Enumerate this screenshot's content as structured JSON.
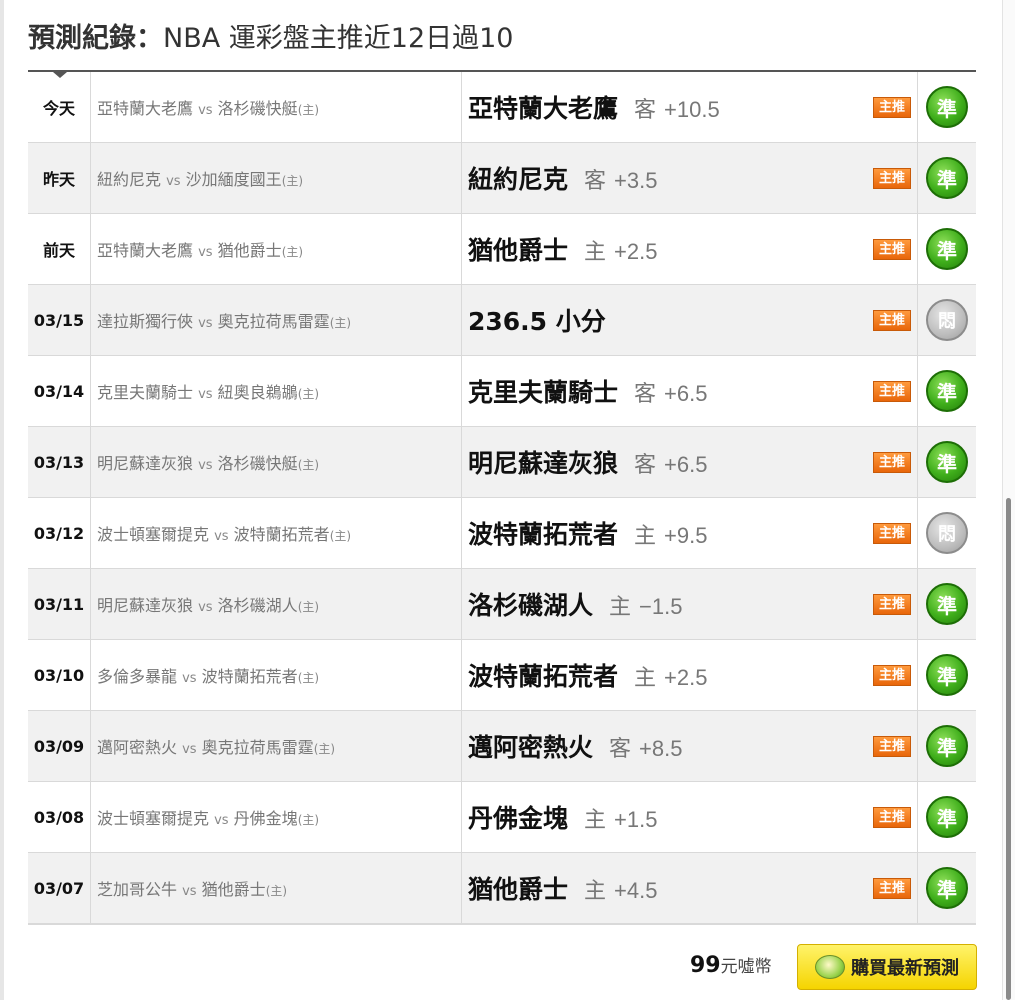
{
  "header": {
    "label": "預測紀錄：",
    "subtitle": "NBA 運彩盤主推近12日過10"
  },
  "records": [
    {
      "date": "今天",
      "away": "亞特蘭大老鷹",
      "vs": "vs",
      "home": "洛杉磯快艇",
      "home_mark": "(主)",
      "pick_team": "亞特蘭大老鷹",
      "pick_side": "客",
      "pick_line": "+10.5",
      "tag": "主推",
      "result": "準"
    },
    {
      "date": "昨天",
      "away": "紐約尼克",
      "vs": "vs",
      "home": "沙加緬度國王",
      "home_mark": "(主)",
      "pick_team": "紐約尼克",
      "pick_side": "客",
      "pick_line": "+3.5",
      "tag": "主推",
      "result": "準"
    },
    {
      "date": "前天",
      "away": "亞特蘭大老鷹",
      "vs": "vs",
      "home": "猶他爵士",
      "home_mark": "(主)",
      "pick_team": "猶他爵士",
      "pick_side": "主",
      "pick_line": "+2.5",
      "tag": "主推",
      "result": "準"
    },
    {
      "date": "03/15",
      "away": "達拉斯獨行俠",
      "vs": "vs",
      "home": "奧克拉荷馬雷霆",
      "home_mark": "(主)",
      "pick_team": "236.5 小分",
      "pick_side": "",
      "pick_line": "",
      "tag": "主推",
      "result": "悶"
    },
    {
      "date": "03/14",
      "away": "克里夫蘭騎士",
      "vs": "vs",
      "home": "紐奧良鵜鶘",
      "home_mark": "(主)",
      "pick_team": "克里夫蘭騎士",
      "pick_side": "客",
      "pick_line": "+6.5",
      "tag": "主推",
      "result": "準"
    },
    {
      "date": "03/13",
      "away": "明尼蘇達灰狼",
      "vs": "vs",
      "home": "洛杉磯快艇",
      "home_mark": "(主)",
      "pick_team": "明尼蘇達灰狼",
      "pick_side": "客",
      "pick_line": "+6.5",
      "tag": "主推",
      "result": "準"
    },
    {
      "date": "03/12",
      "away": "波士頓塞爾提克",
      "vs": "vs",
      "home": "波特蘭拓荒者",
      "home_mark": "(主)",
      "pick_team": "波特蘭拓荒者",
      "pick_side": "主",
      "pick_line": "+9.5",
      "tag": "主推",
      "result": "悶"
    },
    {
      "date": "03/11",
      "away": "明尼蘇達灰狼",
      "vs": "vs",
      "home": "洛杉磯湖人",
      "home_mark": "(主)",
      "pick_team": "洛杉磯湖人",
      "pick_side": "主",
      "pick_line": "−1.5",
      "tag": "主推",
      "result": "準"
    },
    {
      "date": "03/10",
      "away": "多倫多暴龍",
      "vs": "vs",
      "home": "波特蘭拓荒者",
      "home_mark": "(主)",
      "pick_team": "波特蘭拓荒者",
      "pick_side": "主",
      "pick_line": "+2.5",
      "tag": "主推",
      "result": "準"
    },
    {
      "date": "03/09",
      "away": "邁阿密熱火",
      "vs": "vs",
      "home": "奧克拉荷馬雷霆",
      "home_mark": "(主)",
      "pick_team": "邁阿密熱火",
      "pick_side": "客",
      "pick_line": "+8.5",
      "tag": "主推",
      "result": "準"
    },
    {
      "date": "03/08",
      "away": "波士頓塞爾提克",
      "vs": "vs",
      "home": "丹佛金塊",
      "home_mark": "(主)",
      "pick_team": "丹佛金塊",
      "pick_side": "主",
      "pick_line": "+1.5",
      "tag": "主推",
      "result": "準"
    },
    {
      "date": "03/07",
      "away": "芝加哥公牛",
      "vs": "vs",
      "home": "猶他爵士",
      "home_mark": "(主)",
      "pick_team": "猶他爵士",
      "pick_side": "主",
      "pick_line": "+4.5",
      "tag": "主推",
      "result": "準"
    }
  ],
  "footer": {
    "price": "99",
    "unit": "元噓幣",
    "buy_label": "購買最新預測"
  },
  "colors": {
    "win": "#3fae1b",
    "void": "#bdbdbd",
    "tag": "#f07a1a",
    "buy": "#f7dc1a"
  }
}
